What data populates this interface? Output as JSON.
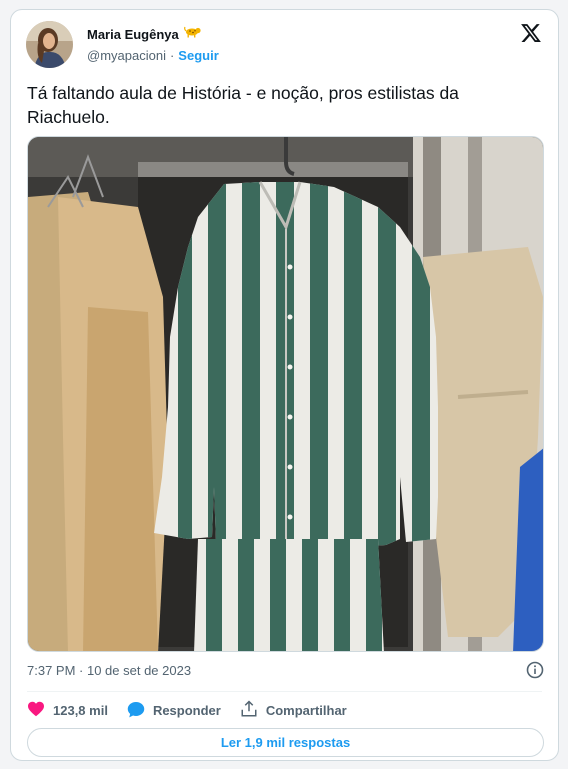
{
  "author": {
    "name": "Maria Eugênya",
    "handle": "@myapacioni",
    "separator": "·",
    "follow_label": "Seguir"
  },
  "tweet": {
    "text": "Tá faltando aula de História - e noção, pros estilistas da Riachuelo.",
    "timestamp": "7:37 PM · 10 de set de 2023"
  },
  "actions": {
    "likes": "123,8 mil",
    "reply_label": "Responder",
    "share_label": "Compartilhar"
  },
  "replies_button": "Ler 1,9 mil respostas",
  "icons": [
    "avatar",
    "leopard-emoji-icon",
    "x-logo-icon",
    "info-icon",
    "heart-icon",
    "reply-bubble-icon",
    "share-icon"
  ],
  "colors": {
    "accent": "#1d9bf0",
    "like": "#f91880",
    "text": "#0f1419",
    "muted": "#536471"
  }
}
